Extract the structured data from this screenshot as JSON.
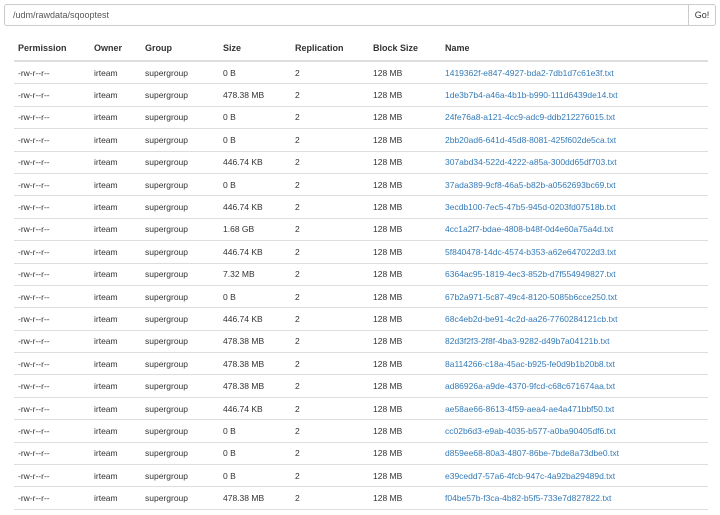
{
  "search": {
    "path": "/udm/rawdata/sqooptest",
    "go_label": "Go!"
  },
  "table": {
    "headers": [
      "Permission",
      "Owner",
      "Group",
      "Size",
      "Replication",
      "Block Size",
      "Name"
    ],
    "rows": [
      [
        "-rw-r--r--",
        "irteam",
        "supergroup",
        "0 B",
        "2",
        "128 MB",
        "1419362f-e847-4927-bda2-7db1d7c61e3f.txt"
      ],
      [
        "-rw-r--r--",
        "irteam",
        "supergroup",
        "478.38 MB",
        "2",
        "128 MB",
        "1de3b7b4-a46a-4b1b-b990-111d6439de14.txt"
      ],
      [
        "-rw-r--r--",
        "irteam",
        "supergroup",
        "0 B",
        "2",
        "128 MB",
        "24fe76a8-a121-4cc9-adc9-ddb212276015.txt"
      ],
      [
        "-rw-r--r--",
        "irteam",
        "supergroup",
        "0 B",
        "2",
        "128 MB",
        "2bb20ad6-641d-45d8-8081-425f602de5ca.txt"
      ],
      [
        "-rw-r--r--",
        "irteam",
        "supergroup",
        "446.74 KB",
        "2",
        "128 MB",
        "307abd34-522d-4222-a85a-300dd65df703.txt"
      ],
      [
        "-rw-r--r--",
        "irteam",
        "supergroup",
        "0 B",
        "2",
        "128 MB",
        "37ada389-9cf8-46a5-b82b-a0562693bc69.txt"
      ],
      [
        "-rw-r--r--",
        "irteam",
        "supergroup",
        "446.74 KB",
        "2",
        "128 MB",
        "3ecdb100-7ec5-47b5-945d-0203fd07518b.txt"
      ],
      [
        "-rw-r--r--",
        "irteam",
        "supergroup",
        "1.68 GB",
        "2",
        "128 MB",
        "4cc1a2f7-bdae-4808-b48f-0d4e60a75a4d.txt"
      ],
      [
        "-rw-r--r--",
        "irteam",
        "supergroup",
        "446.74 KB",
        "2",
        "128 MB",
        "5f840478-14dc-4574-b353-a62e647022d3.txt"
      ],
      [
        "-rw-r--r--",
        "irteam",
        "supergroup",
        "7.32 MB",
        "2",
        "128 MB",
        "6364ac95-1819-4ec3-852b-d7f554949827.txt"
      ],
      [
        "-rw-r--r--",
        "irteam",
        "supergroup",
        "0 B",
        "2",
        "128 MB",
        "67b2a971-5c87-49c4-8120-5085b6cce250.txt"
      ],
      [
        "-rw-r--r--",
        "irteam",
        "supergroup",
        "446.74 KB",
        "2",
        "128 MB",
        "68c4eb2d-be91-4c2d-aa26-7760284121cb.txt"
      ],
      [
        "-rw-r--r--",
        "irteam",
        "supergroup",
        "478.38 MB",
        "2",
        "128 MB",
        "82d3f2f3-2f8f-4ba3-9282-d49b7a04121b.txt"
      ],
      [
        "-rw-r--r--",
        "irteam",
        "supergroup",
        "478.38 MB",
        "2",
        "128 MB",
        "8a114266-c18a-45ac-b925-fe0d9b1b20b8.txt"
      ],
      [
        "-rw-r--r--",
        "irteam",
        "supergroup",
        "478.38 MB",
        "2",
        "128 MB",
        "ad86926a-a9de-4370-9fcd-c68c671674aa.txt"
      ],
      [
        "-rw-r--r--",
        "irteam",
        "supergroup",
        "446.74 KB",
        "2",
        "128 MB",
        "ae58ae66-8613-4f59-aea4-ae4a471bbf50.txt"
      ],
      [
        "-rw-r--r--",
        "irteam",
        "supergroup",
        "0 B",
        "2",
        "128 MB",
        "cc02b6d3-e9ab-4035-b577-a0ba90405df6.txt"
      ],
      [
        "-rw-r--r--",
        "irteam",
        "supergroup",
        "0 B",
        "2",
        "128 MB",
        "d859ee68-80a3-4807-86be-7bde8a73dbe0.txt"
      ],
      [
        "-rw-r--r--",
        "irteam",
        "supergroup",
        "0 B",
        "2",
        "128 MB",
        "e39cedd7-57a6-4fcb-947c-4a92ba29489d.txt"
      ],
      [
        "-rw-r--r--",
        "irteam",
        "supergroup",
        "478.38 MB",
        "2",
        "128 MB",
        "f04be57b-f3ca-4b82-b5f5-733e7d827822.txt"
      ]
    ]
  },
  "colors": {
    "link": "#337ab7",
    "border": "#dddddd",
    "text": "#333333"
  }
}
